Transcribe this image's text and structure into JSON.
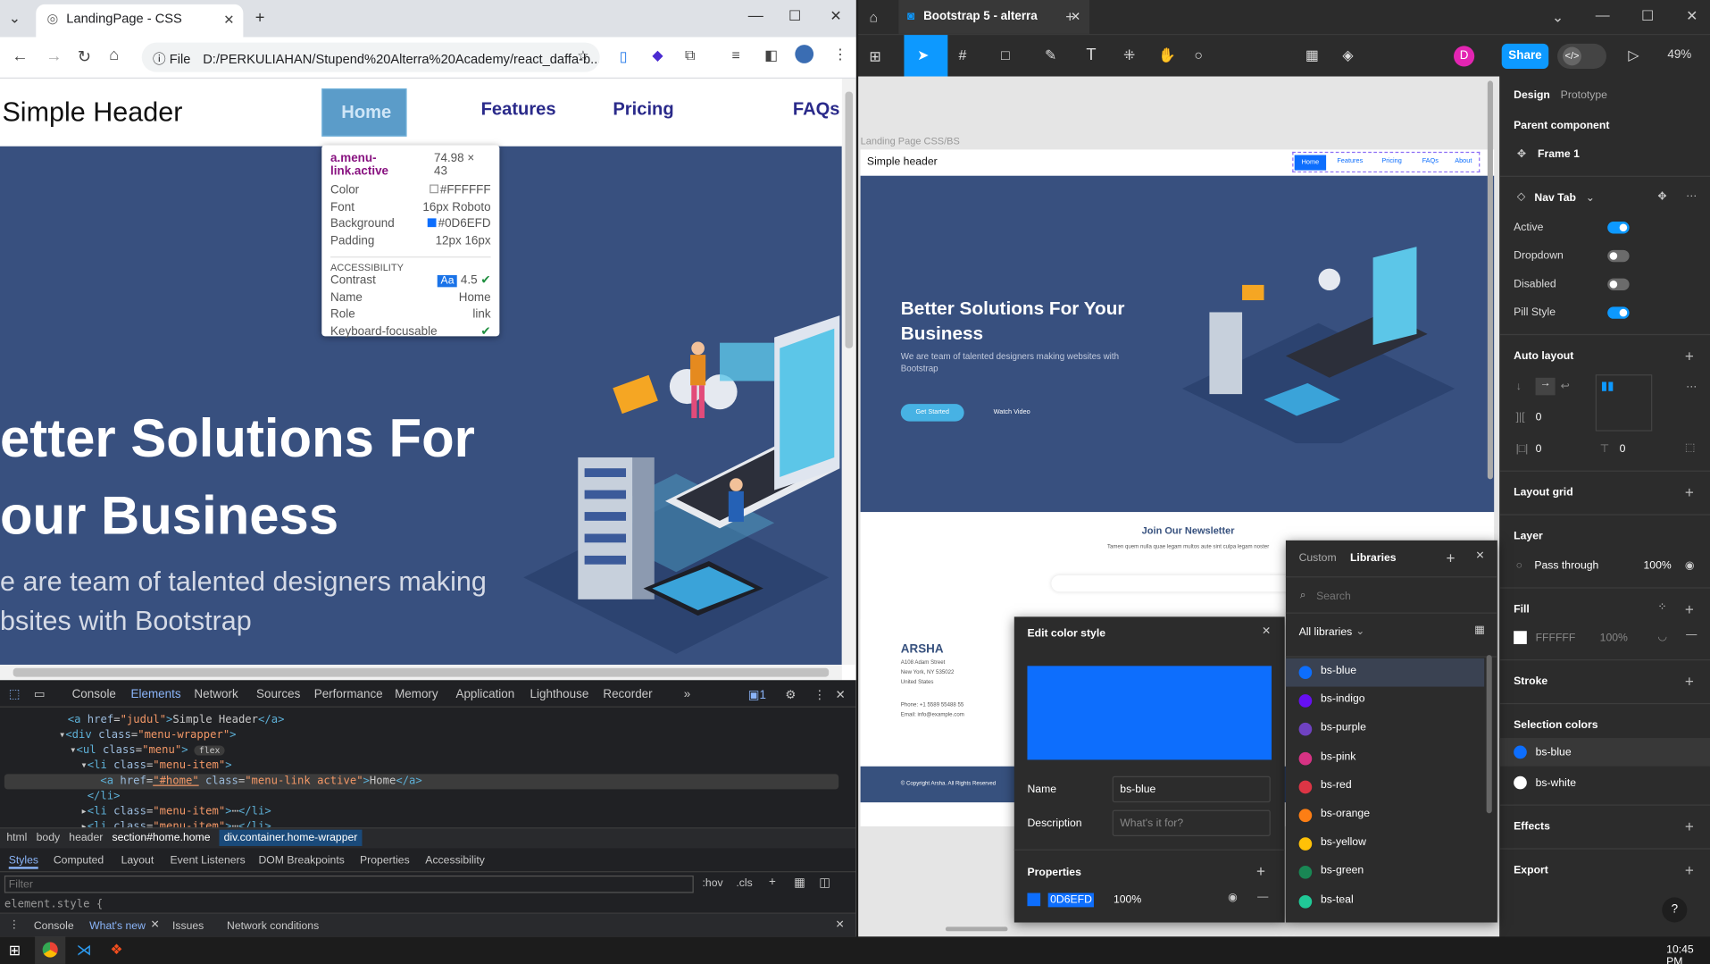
{
  "chrome": {
    "tab_title": "LandingPage - CSS",
    "url_scheme": "File",
    "url": "D:/PERKULIAHAN/Stupend%20Alterra%20Academy/react_daffa-b...",
    "site": {
      "logo": "Simple Header",
      "nav": [
        "Home",
        "Features",
        "Pricing",
        "FAQs"
      ],
      "hero_line1": "etter Solutions For",
      "hero_line2": "our Business",
      "hero_sub1": "e are team of talented designers making",
      "hero_sub2": "bsites with Bootstrap"
    },
    "tooltip": {
      "selector": "a.menu-link.active",
      "size": "74.98 × 43",
      "rows": [
        [
          "Color",
          "#FFFFFF"
        ],
        [
          "Font",
          "16px Roboto"
        ],
        [
          "Background",
          "#0D6EFD"
        ],
        [
          "Padding",
          "12px 16px"
        ]
      ],
      "section": "ACCESSIBILITY",
      "acc": [
        [
          "Contrast",
          "4.5"
        ],
        [
          "Name",
          "Home"
        ],
        [
          "Role",
          "link"
        ],
        [
          "Keyboard-focusable",
          ""
        ]
      ],
      "aa": "Aa"
    },
    "devtools": {
      "tabs": [
        "Console",
        "Elements",
        "Network",
        "Sources",
        "Performance",
        "Memory",
        "Application",
        "Lighthouse",
        "Recorder"
      ],
      "badge": "1",
      "code": [
        {
          "indent": 58,
          "html": "<a href=\"judul\">Simple Header</a>"
        },
        {
          "indent": 52,
          "html": "<div class=\"menu-wrapper\">"
        },
        {
          "indent": 64,
          "html": "<ul class=\"menu\">"
        },
        {
          "indent": 76,
          "html": "<li class=\"menu-item\">"
        },
        {
          "indent": 88,
          "html": "<a href=\"#home\" class=\"menu-link active\">Home</a>"
        },
        {
          "indent": 80,
          "html": "</li>"
        },
        {
          "indent": 72,
          "html": "<li class=\"menu-item\">"
        },
        {
          "indent": 72,
          "html": "<li class=\"menu-item\">"
        }
      ],
      "flex_badge": "flex",
      "breadcrumb": [
        "html",
        "body",
        "header",
        "section#home.home",
        "div.container.home-wrapper"
      ],
      "subtabs": [
        "Styles",
        "Computed",
        "Layout",
        "Event Listeners",
        "DOM Breakpoints",
        "Properties",
        "Accessibility"
      ],
      "filter_placeholder": "Filter",
      "hov": ":hov",
      "cls": ".cls",
      "element_style": "element.style {",
      "drawer_tabs": [
        "Console",
        "What's new",
        "Issues",
        "Network conditions"
      ]
    }
  },
  "figma": {
    "tab_title": "Bootstrap 5 - alterra",
    "share": "Share",
    "zoom": "49%",
    "avatar": "D",
    "frame_label": "Landing Page CSS/BS",
    "mock": {
      "header": "Simple header",
      "nav": [
        "Home",
        "Features",
        "Pricing",
        "FAQs",
        "About"
      ],
      "title1": "Better Solutions For Your",
      "title2": "Business",
      "sub1": "We are team of talented designers making websites with",
      "sub2": "Bootstrap",
      "cta": "Get Started",
      "video": "Watch Video",
      "news_title": "Join Our Newsletter",
      "news_sub": "Tamen quem nulla quae legam multos aute sint culpa legam noster",
      "brand": "ARSHA",
      "addr": [
        "A108 Adam Street",
        "New York, NY 535022",
        "United States"
      ],
      "phone": "Phone: +1 5589 55488 55",
      "email": "Email: info@example.com",
      "copyright": "© Copyright Arsha. All Rights Reserved"
    },
    "panel": {
      "tabs": [
        "Design",
        "Prototype"
      ],
      "parent": "Parent component",
      "frame": "Frame 1",
      "component": "Nav Tab",
      "props": [
        [
          "Active",
          true
        ],
        [
          "Dropdown",
          false
        ],
        [
          "Disabled",
          false
        ],
        [
          "Pill Style",
          true
        ]
      ],
      "auto_layout": "Auto layout",
      "al_vals": [
        "0",
        "0",
        "0"
      ],
      "layout_grid": "Layout grid",
      "layer": "Layer",
      "blend": "Pass through",
      "opacity": "100%",
      "fill": "Fill",
      "fill_hex": "FFFFFF",
      "fill_op": "100%",
      "stroke": "Stroke",
      "sel_colors": "Selection colors",
      "colors": [
        "bs-blue",
        "bs-white"
      ],
      "effects": "Effects",
      "export": "Export",
      "help": "?"
    },
    "ecs": {
      "title": "Edit color style",
      "swatch": "#0d6efd",
      "name_label": "Name",
      "name": "bs-blue",
      "desc_label": "Description",
      "desc_placeholder": "What's it for?",
      "props_label": "Properties",
      "hex": "0D6EFD",
      "opacity": "100%"
    },
    "libs": {
      "tabs": [
        "Custom",
        "Libraries"
      ],
      "search": "Search",
      "filter": "All libraries",
      "items": [
        [
          "bs-blue",
          "#0d6efd"
        ],
        [
          "bs-indigo",
          "#6610f2"
        ],
        [
          "bs-purple",
          "#6f42c1"
        ],
        [
          "bs-pink",
          "#d63384"
        ],
        [
          "bs-red",
          "#dc3545"
        ],
        [
          "bs-orange",
          "#fd7e14"
        ],
        [
          "bs-yellow",
          "#ffc107"
        ],
        [
          "bs-green",
          "#198754"
        ],
        [
          "bs-teal",
          "#20c997"
        ]
      ]
    }
  },
  "taskbar": {
    "time": "10:45 PM"
  }
}
